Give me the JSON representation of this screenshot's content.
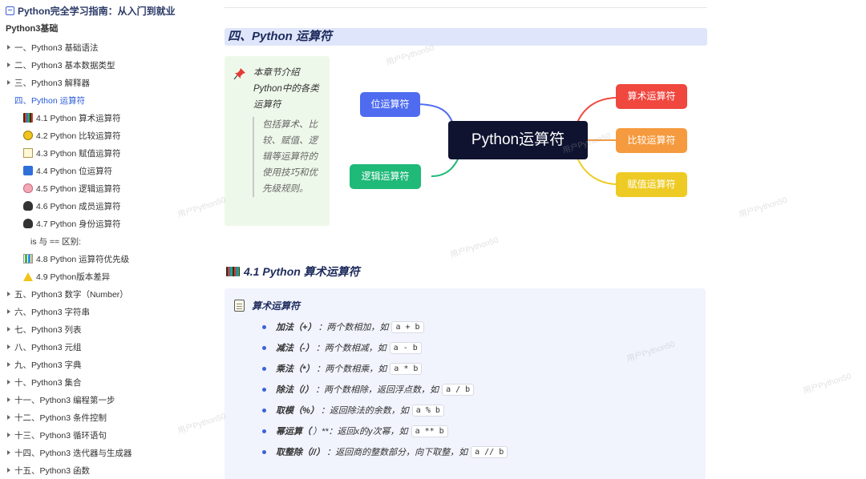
{
  "sidebar": {
    "doc_title": "Python完全学习指南：从入门到就业",
    "section_title": "Python3基础",
    "items": [
      {
        "label": "一、Python3 基础语法",
        "level": 1,
        "caret": true
      },
      {
        "label": "二、Python3 基本数据类型",
        "level": 1,
        "caret": true
      },
      {
        "label": "三、Python3 解释器",
        "level": 1,
        "caret": true
      },
      {
        "label": "四、Python 运算符",
        "level": 1,
        "caret": false,
        "active": true
      },
      {
        "label": "4.1 Python 算术运算符",
        "level": 2,
        "icon": "abacus-icon"
      },
      {
        "label": "4.2 Python 比较运算符",
        "level": 2,
        "icon": "face-icon"
      },
      {
        "label": "4.3 Python 赋值运算符",
        "level": 2,
        "icon": "memo-icon"
      },
      {
        "label": "4.4 Python 位运算符",
        "level": 2,
        "icon": "grid-icon"
      },
      {
        "label": "4.5 Python 逻辑运算符",
        "level": 2,
        "icon": "brain-icon"
      },
      {
        "label": "4.6 Python 成员运算符",
        "level": 2,
        "icon": "spy-icon"
      },
      {
        "label": "4.7 Python 身份运算符",
        "level": 2,
        "icon": "spy-icon"
      },
      {
        "label": "is 与 == 区别:",
        "level": 3
      },
      {
        "label": "4.8 Python 运算符优先级",
        "level": 2,
        "icon": "bar-chart-icon"
      },
      {
        "label": "4.9 Python版本差异",
        "level": 2,
        "icon": "warning-icon"
      },
      {
        "label": "五、Python3 数字（Number）",
        "level": 1,
        "caret": true
      },
      {
        "label": "六、Python3 字符串",
        "level": 1,
        "caret": true
      },
      {
        "label": "七、Python3 列表",
        "level": 1,
        "caret": true
      },
      {
        "label": "八、Python3 元组",
        "level": 1,
        "caret": true
      },
      {
        "label": "九、Python3 字典",
        "level": 1,
        "caret": true
      },
      {
        "label": "十、Python3 集合",
        "level": 1,
        "caret": true
      },
      {
        "label": "十一、Python3 编程第一步",
        "level": 1,
        "caret": true
      },
      {
        "label": "十二、Python3 条件控制",
        "level": 1,
        "caret": true
      },
      {
        "label": "十三、Python3 循环语句",
        "level": 1,
        "caret": true
      },
      {
        "label": "十四、Python3 迭代器与生成器",
        "level": 1,
        "caret": true
      },
      {
        "label": "十五、Python3 函数",
        "level": 1,
        "caret": true
      }
    ]
  },
  "main": {
    "section_heading": "四、Python 运算符",
    "callout": {
      "text": "本章节介绍Python中的各类运算符",
      "quote": "包括算术、比较、赋值、逻辑等运算符的使用技巧和优先级规则。"
    },
    "mindmap": {
      "center": "Python运算符",
      "left": [
        "位运算符",
        "逻辑运算符"
      ],
      "right": [
        "算术运算符",
        "比较运算符",
        "赋值运算符"
      ],
      "colors": {
        "位运算符": "#4f6cf0",
        "逻辑运算符": "#1fb978",
        "算术运算符": "#f0473f",
        "比较运算符": "#f59a3e",
        "赋值运算符": "#eecb24"
      }
    },
    "subsection_heading": "4.1 Python 算术运算符",
    "card": {
      "title": "算术运算符",
      "ops": [
        {
          "name": "加法（+）",
          "desc": "：两个数相加，如",
          "code": "a + b"
        },
        {
          "name": "减法（-）",
          "desc": "：两个数相减，如",
          "code": "a - b"
        },
        {
          "name": "乘法（*）",
          "desc": "：两个数相乘，如",
          "code": "a * b"
        },
        {
          "name": "除法（/）",
          "desc": "：两个数相除，返回浮点数，如",
          "code": "a / b"
        },
        {
          "name": "取模（%）",
          "desc": "：返回除法的余数，如",
          "code": "a % b"
        },
        {
          "name": "幂运算（",
          "desc": "）**：返回x的y次幂，如",
          "code": "a ** b"
        },
        {
          "name": "取整除（//）",
          "desc": "：返回商的整数部分，向下取整，如",
          "code": "a // b"
        }
      ]
    }
  },
  "watermark": "用户Python50"
}
